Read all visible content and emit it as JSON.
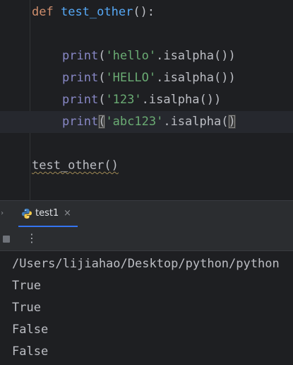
{
  "editor": {
    "lines": [
      {
        "kw": "def",
        "fn": "test_other",
        "rest": "():"
      },
      {
        "builtin": "print",
        "open": "(",
        "str": "'hello'",
        "rest": ".isalpha())"
      },
      {
        "builtin": "print",
        "open": "(",
        "str": "'HELLO'",
        "rest": ".isalpha())"
      },
      {
        "builtin": "print",
        "open": "(",
        "str": "'123'",
        "rest": ".isalpha())"
      },
      {
        "builtin": "print",
        "open": "(",
        "str": "'abc123'",
        "rest": ".isalpha(",
        "close": ")"
      },
      {
        "call": "test_other()"
      }
    ]
  },
  "run_panel": {
    "tab_label": "test1",
    "close_glyph": "×",
    "more_glyph": "⋮",
    "collapse_glyph": "›",
    "icons": [
      "python-icon",
      "stop-icon",
      "more-options-icon",
      "close-icon"
    ]
  },
  "console": {
    "lines": [
      "/Users/lijiahao/Desktop/python/python",
      "True",
      "True",
      "False",
      "False"
    ]
  }
}
